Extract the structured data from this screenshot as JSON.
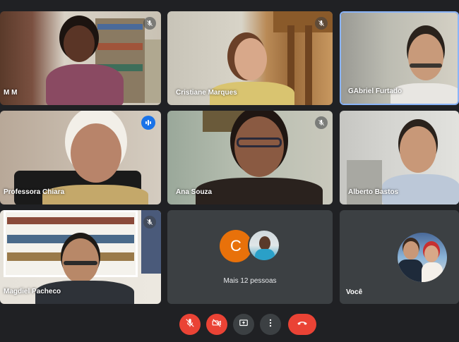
{
  "participants": [
    {
      "name": "M M",
      "muted": true,
      "speaking": false
    },
    {
      "name": "Cristiane Marques",
      "muted": true,
      "speaking": false
    },
    {
      "name": "GAbriel Furtado",
      "muted": true,
      "speaking": false,
      "pinned_highlight": true
    },
    {
      "name": "Professora Chiara",
      "muted": false,
      "speaking": true
    },
    {
      "name": "Ana Souza",
      "muted": true,
      "speaking": false
    },
    {
      "name": "Alberto Bastos",
      "muted": false,
      "speaking": false
    },
    {
      "name": "Magdiel Pacheco",
      "muted": true,
      "speaking": false
    }
  ],
  "more_tile": {
    "avatar_letter": "C",
    "label": "Mais 12 pessoas"
  },
  "self_tile": {
    "name": "Você"
  },
  "controls": {
    "mic": "mic-off-icon",
    "camera": "camera-off-icon",
    "present": "present-screen-icon",
    "more": "more-options-icon",
    "hangup": "hang-up-icon"
  },
  "colors": {
    "background": "#202124",
    "tile_dark": "#3c4043",
    "danger": "#ea4335",
    "accent": "#1a73e8",
    "avatar_orange": "#e8710a"
  }
}
